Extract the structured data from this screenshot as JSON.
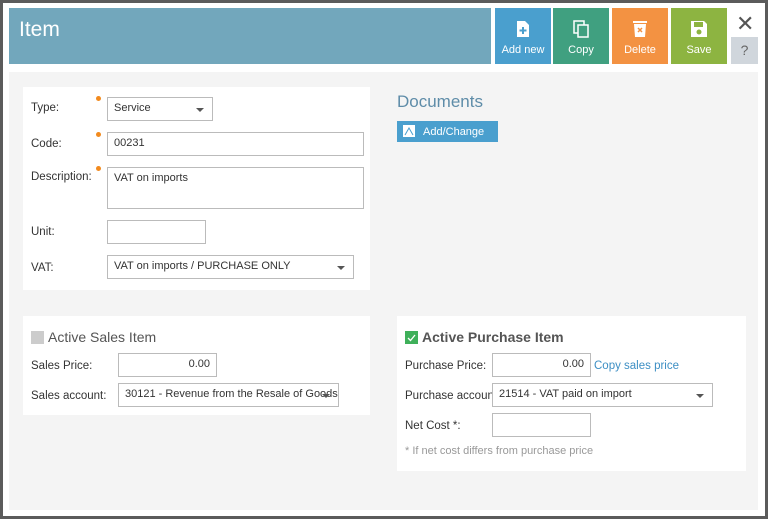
{
  "header": {
    "title": "Item"
  },
  "toolbar": {
    "add_new": "Add new",
    "copy": "Copy",
    "delete": "Delete",
    "save": "Save",
    "help": "?",
    "close": "✕"
  },
  "colors": {
    "header": "#72a7bc",
    "add_new": "#4a9fce",
    "copy": "#40a080",
    "delete": "#f39242",
    "save": "#8db441",
    "required": "#f28a1e"
  },
  "form": {
    "type_label": "Type:",
    "type_value": "Service",
    "code_label": "Code:",
    "code_value": "00231",
    "description_label": "Description:",
    "description_value": "VAT on imports",
    "unit_label": "Unit:",
    "unit_value": "",
    "vat_label": "VAT:",
    "vat_value": "VAT on imports / PURCHASE ONLY"
  },
  "documents": {
    "title": "Documents",
    "add_change": "Add/Change"
  },
  "sales": {
    "title": "Active Sales Item",
    "checked": false,
    "price_label": "Sales Price:",
    "price_value": "0.00",
    "account_label": "Sales account:",
    "account_value": "30121 - Revenue from the Resale of Goods"
  },
  "purchase": {
    "title": "Active Purchase Item",
    "checked": true,
    "price_label": "Purchase Price:",
    "price_value": "0.00",
    "copy_sales_price": "Copy sales price",
    "account_label": "Purchase account:",
    "account_value": "21514 - VAT paid on import",
    "net_cost_label": "Net Cost *:",
    "net_cost_value": "",
    "note": "* If net cost differs from purchase price"
  }
}
